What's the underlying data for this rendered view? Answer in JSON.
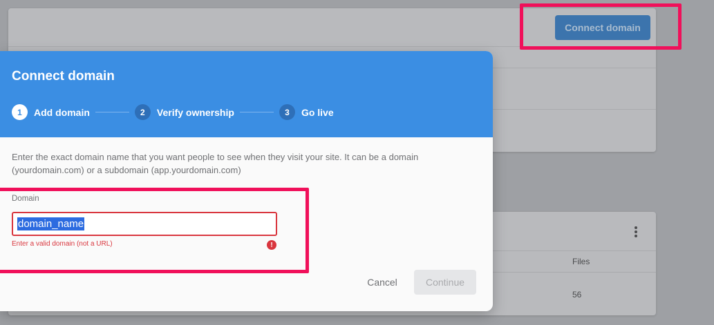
{
  "background": {
    "connect_button_label": "Connect domain",
    "files_column_header": "Files",
    "files_value": "56"
  },
  "dialog": {
    "title": "Connect domain",
    "steps": [
      {
        "number": "1",
        "label": "Add domain",
        "active": true
      },
      {
        "number": "2",
        "label": "Verify ownership",
        "active": false
      },
      {
        "number": "3",
        "label": "Go live",
        "active": false
      }
    ],
    "description": "Enter the exact domain name that you want people to see when they visit your site. It can be a domain (yourdomain.com) or a subdomain (app.yourdomain.com)",
    "domain_field": {
      "label": "Domain",
      "value": "domain_name",
      "error": "Enter a valid domain (not a URL)",
      "error_icon": "!"
    },
    "cancel_label": "Cancel",
    "continue_label": "Continue"
  },
  "colors": {
    "header_blue": "#3b8ee3",
    "highlight": "#f0105a",
    "error": "#d9363e"
  }
}
